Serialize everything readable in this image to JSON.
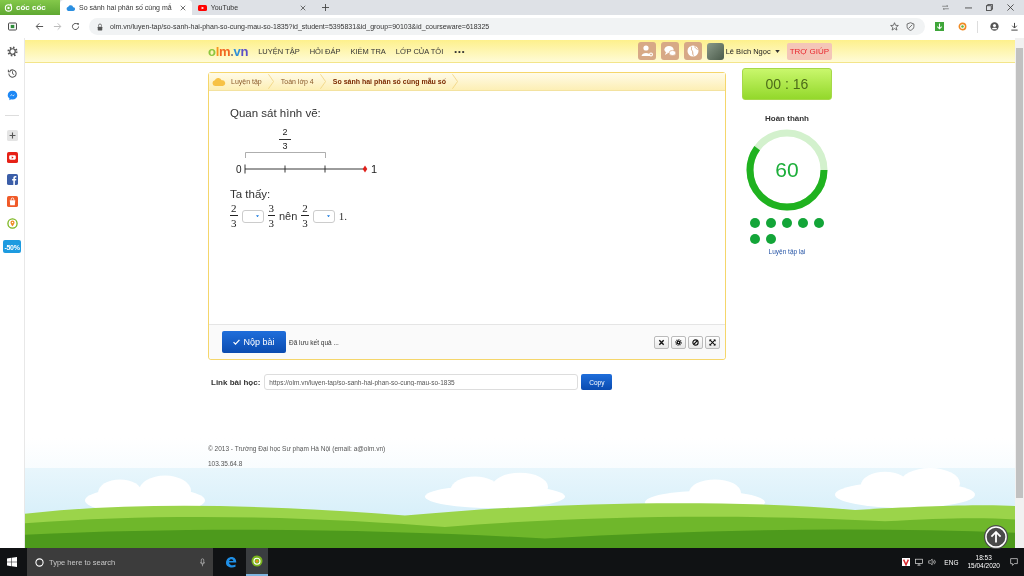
{
  "browser": {
    "logo": "cốc cốc",
    "tabs": [
      {
        "kind": "page",
        "title": "So sánh hai phân số cùng mẫ",
        "selected": true
      },
      {
        "kind": "video",
        "title": "YouTube",
        "selected": false
      }
    ],
    "address": "olm.vn/luyen-tap/so-sanh-hai-phan-so-cung-mau-so-1835?id_student=5395831&id_group=90103&id_courseware=618325"
  },
  "sidebar": {
    "badge": "-50%"
  },
  "site_header": {
    "logo": "olm.vn",
    "nav": [
      "LUYỆN TẬP",
      "HỎI ĐÁP",
      "KIỂM TRA",
      "LỚP CỦA TÔI"
    ],
    "more": "•••",
    "user_name": "Lê Bích Ngọc",
    "help": "TRỢ GIÚP"
  },
  "breadcrumb": [
    {
      "label": "Luyện tập",
      "selected": false
    },
    {
      "label": "Toán lớp 4",
      "selected": false
    },
    {
      "label": "So sánh hai phân số cùng mẫu số",
      "selected": true
    }
  ],
  "question": {
    "prompt": "Quan sát hình vẽ:",
    "number_line": {
      "start_label": "0",
      "end_label": "1",
      "bracket_label": {
        "numerator": "2",
        "denominator": "3"
      }
    },
    "observation": "Ta thấy:",
    "statement": [
      {
        "kind": "fraction",
        "numerator": "2",
        "denominator": "3"
      },
      {
        "kind": "select"
      },
      {
        "kind": "fraction",
        "numerator": "3",
        "denominator": "3"
      },
      {
        "kind": "text",
        "text": "nên"
      },
      {
        "kind": "fraction",
        "numerator": "2",
        "denominator": "3"
      },
      {
        "kind": "select"
      },
      {
        "kind": "text",
        "text": "1."
      }
    ]
  },
  "actions": {
    "submit": "Nộp bài",
    "save_status": "Đã lưu kết quả ..."
  },
  "lesson_link": {
    "label": "Link bài học:",
    "value": "https://olm.vn/luyen-tap/so-sanh-hai-phan-so-cung-mau-so-1835",
    "button": "Copy"
  },
  "progress": {
    "timer": "00 : 16",
    "title": "Hoàn thành",
    "score": "60",
    "level": 0.6,
    "results": [
      {
        "color": "#13a538"
      },
      {
        "color": "#13a538"
      },
      {
        "color": "#13a538"
      },
      {
        "color": "#13a538"
      },
      {
        "color": "#13a538"
      },
      {
        "color": "#13a538"
      },
      {
        "color": "#13a538"
      }
    ],
    "retry": "Luyện tập lại"
  },
  "footer": {
    "copyright": "© 2013 - Trường Đại học Sư phạm Hà Nội (email: a@olm.vn)",
    "ip": "103.35.64.8"
  },
  "taskbar": {
    "search_placeholder": "Type here to search",
    "language": "ENG",
    "time": "18:53",
    "date": "15/04/2020"
  }
}
